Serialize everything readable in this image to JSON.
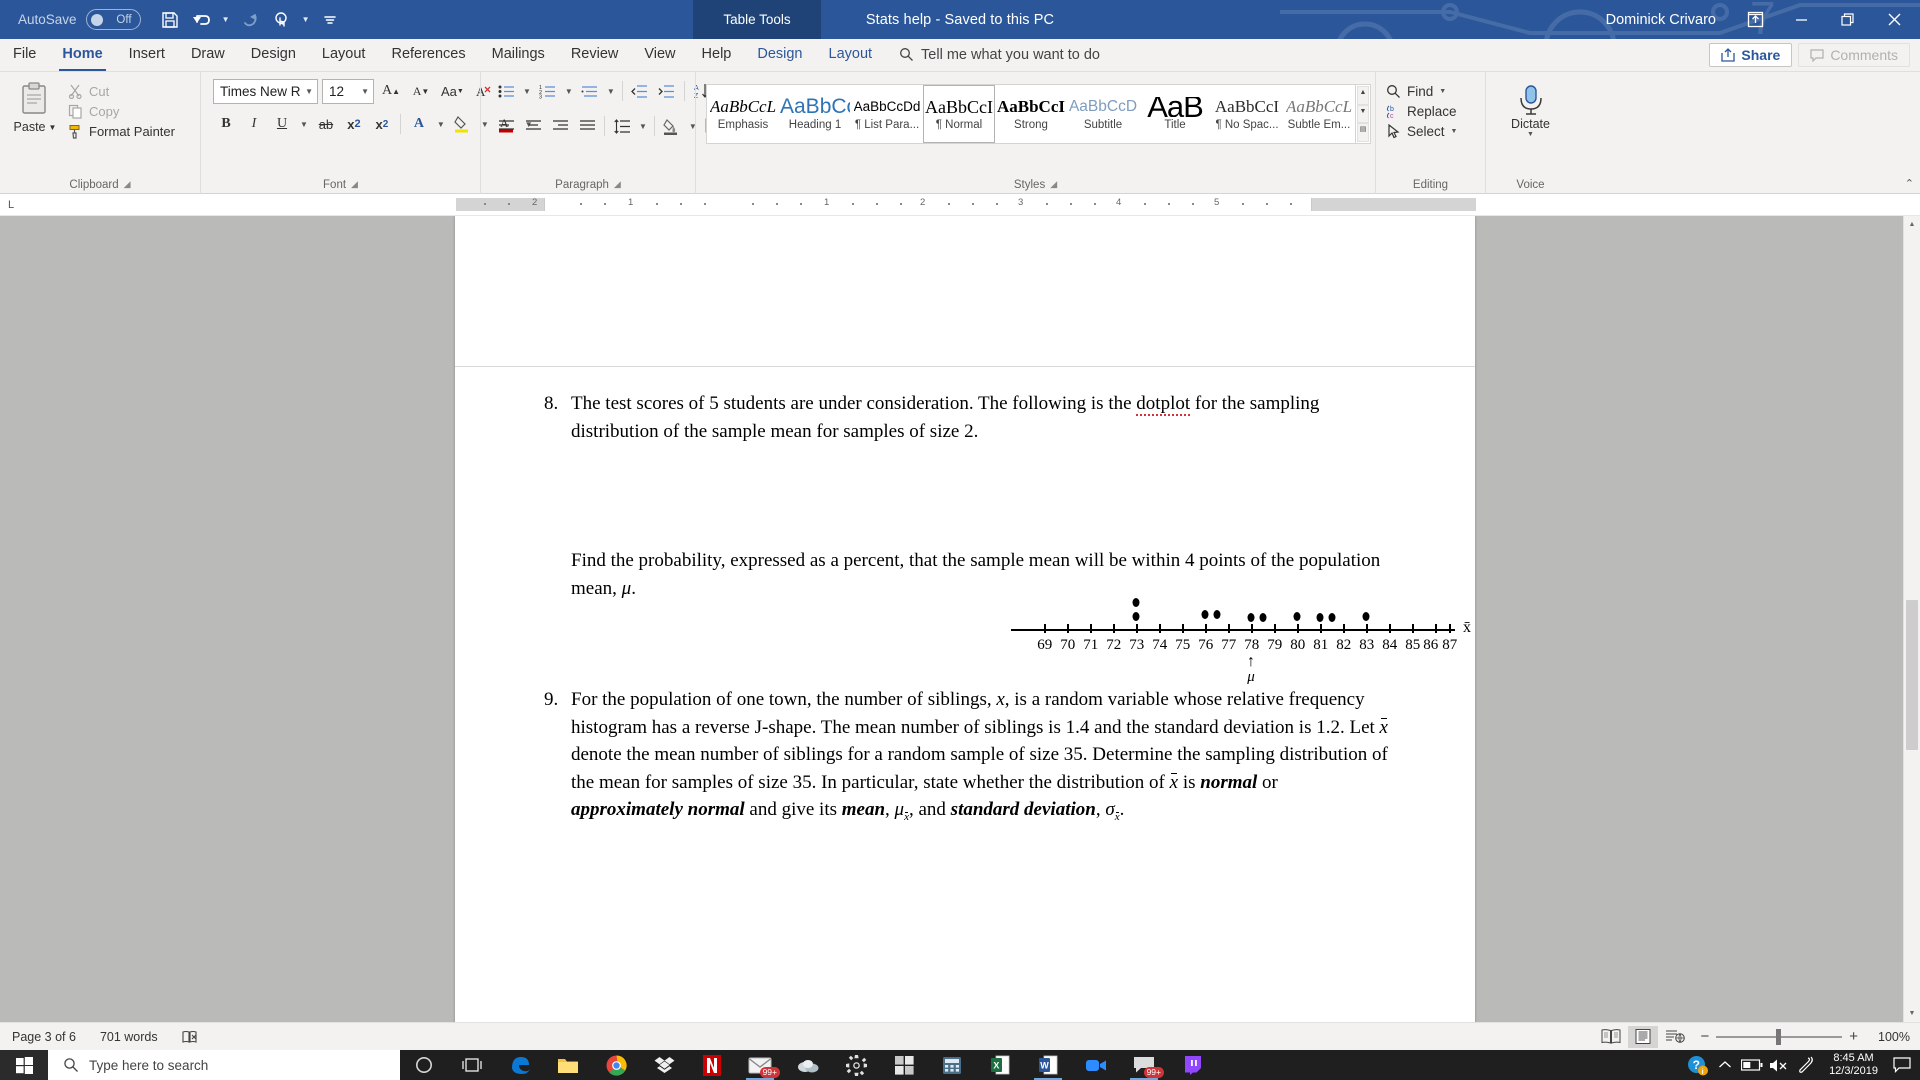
{
  "titlebar": {
    "autosave_label": "AutoSave",
    "autosave_state": "Off",
    "document_title": "Stats help  -  Saved to this PC",
    "contextual_tab": "Table Tools",
    "username": "Dominick Crivaro",
    "quick_access": [
      "save-icon",
      "undo-icon",
      "redo-icon",
      "touch-mode-icon",
      "customize-qat-icon"
    ],
    "window_controls": [
      "ribbon-display-options-icon",
      "minimize-icon",
      "restore-icon",
      "close-icon"
    ],
    "accent_color": "#2b579a",
    "contextual_color": "#1f4277"
  },
  "ribbon": {
    "tabs": [
      {
        "label": "File",
        "active": false,
        "contextual": false
      },
      {
        "label": "Home",
        "active": true,
        "contextual": false
      },
      {
        "label": "Insert",
        "active": false,
        "contextual": false
      },
      {
        "label": "Draw",
        "active": false,
        "contextual": false
      },
      {
        "label": "Design",
        "active": false,
        "contextual": false
      },
      {
        "label": "Layout",
        "active": false,
        "contextual": false
      },
      {
        "label": "References",
        "active": false,
        "contextual": false
      },
      {
        "label": "Mailings",
        "active": false,
        "contextual": false
      },
      {
        "label": "Review",
        "active": false,
        "contextual": false
      },
      {
        "label": "View",
        "active": false,
        "contextual": false
      },
      {
        "label": "Help",
        "active": false,
        "contextual": false
      },
      {
        "label": "Design",
        "active": false,
        "contextual": true
      },
      {
        "label": "Layout",
        "active": false,
        "contextual": true
      }
    ],
    "tellme_placeholder": "Tell me what you want to do",
    "share_label": "Share",
    "comments_label": "Comments",
    "clipboard": {
      "group_label": "Clipboard",
      "paste_label": "Paste",
      "cut_label": "Cut",
      "copy_label": "Copy",
      "format_painter_label": "Format Painter"
    },
    "font": {
      "group_label": "Font",
      "font_name": "Times New Rom",
      "font_size": "12",
      "buttons": [
        "grow-font-icon",
        "shrink-font-icon",
        "change-case-icon",
        "clear-formatting-icon",
        "bold-icon",
        "italic-icon",
        "underline-icon",
        "strikethrough-icon",
        "subscript-icon",
        "superscript-icon",
        "text-effects-icon",
        "text-highlight-icon",
        "font-color-icon"
      ],
      "bold_label": "B",
      "italic_label": "I",
      "underline_label": "U",
      "strikethrough_label": "ab",
      "subscript_label": "x",
      "superscript_label": "x",
      "case_label": "Aa"
    },
    "paragraph": {
      "group_label": "Paragraph",
      "buttons": [
        "bullets-icon",
        "numbering-icon",
        "multilevel-list-icon",
        "decrease-indent-icon",
        "increase-indent-icon",
        "sort-icon",
        "show-formatting-marks-icon",
        "align-left-icon",
        "align-center-icon",
        "align-right-icon",
        "justify-icon",
        "line-spacing-icon",
        "shading-icon",
        "borders-icon"
      ]
    },
    "styles": {
      "group_label": "Styles",
      "items": [
        {
          "preview": "AaBbCcL",
          "name": "Emphasis",
          "selected": false,
          "style": "emphasis"
        },
        {
          "preview": "AaBbCc",
          "name": "Heading 1",
          "selected": false,
          "style": "heading1"
        },
        {
          "preview": "AaBbCcDd",
          "name": "¶ List Para...",
          "selected": false,
          "style": "listpara"
        },
        {
          "preview": "AaBbCcI",
          "name": "¶ Normal",
          "selected": true,
          "style": "normal"
        },
        {
          "preview": "AaBbCcI",
          "name": "Strong",
          "selected": false,
          "style": "strong"
        },
        {
          "preview": "AaBbCcD",
          "name": "Subtitle",
          "selected": false,
          "style": "subtitle"
        },
        {
          "preview": "AaB",
          "name": "Title",
          "selected": false,
          "style": "title"
        },
        {
          "preview": "AaBbCcI",
          "name": "¶ No Spac...",
          "selected": false,
          "style": "nospacing"
        },
        {
          "preview": "AaBbCcL",
          "name": "Subtle Em...",
          "selected": false,
          "style": "subtleem"
        }
      ]
    },
    "editing": {
      "group_label": "Editing",
      "find_label": "Find",
      "replace_label": "Replace",
      "select_label": "Select"
    },
    "voice": {
      "group_label": "Voice",
      "dictate_label": "Dictate"
    }
  },
  "ruler": {
    "corner_marker": "L",
    "labels": [
      "2",
      "1",
      "1",
      "2",
      "3",
      "4",
      "5"
    ]
  },
  "document": {
    "questions": [
      {
        "number": "8.",
        "lines": [
          "The test scores of 5 students are under consideration. The following is the dotplot for the sampling",
          "distribution of the sample mean for samples of size 2."
        ],
        "misspelled_word": "dotplot"
      },
      {
        "number": "",
        "lines": [
          "Find the probability, expressed as a percent, that the sample mean will be within 4 points of the population",
          "mean, μ."
        ]
      },
      {
        "number": "9.",
        "lines": [
          "For the population of one town, the number of siblings, x, is a random variable whose relative frequency",
          "histogram has a reverse J-shape.  The mean number of siblings is 1.4 and the standard deviation is 1.2.  Let x̄",
          "denote the mean number of siblings for a random sample of size 35. Determine the sampling distribution of",
          "the mean for samples of size 35.  In particular, state whether the distribution of x̄ is normal or",
          "approximately normal and give its mean, μₓ̄, and standard deviation, σₓ̄."
        ]
      }
    ]
  },
  "chart_data": {
    "type": "scatter",
    "title": "Dotplot of sampling distribution of the sample mean (samples of size 2)",
    "xlabel": "x̄",
    "xlim": [
      69,
      87
    ],
    "tick_labels": [
      "69",
      "70",
      "71",
      "72",
      "73",
      "74",
      "75",
      "76",
      "77",
      "78",
      "79",
      "80",
      "81",
      "82",
      "83",
      "84",
      "85",
      "86",
      "87"
    ],
    "grid": false,
    "legend": "none",
    "annotations": [
      {
        "label": "μ",
        "x": 78,
        "marker": "up-arrow",
        "position": "below-axis"
      }
    ],
    "dots": [
      {
        "x": 73,
        "stack": 1
      },
      {
        "x": 73,
        "stack": 2
      },
      {
        "x": 76,
        "stack": 1
      },
      {
        "x": 76.5,
        "stack": 1
      },
      {
        "x": 78,
        "stack": 1
      },
      {
        "x": 78.5,
        "stack": 1
      },
      {
        "x": 80,
        "stack": 1
      },
      {
        "x": 81,
        "stack": 1
      },
      {
        "x": 81.5,
        "stack": 1
      },
      {
        "x": 83,
        "stack": 1
      }
    ]
  },
  "statusbar": {
    "page_info": "Page 3 of 6",
    "word_count": "701 words",
    "proofing_icon": "proofing-errors-icon",
    "views": [
      {
        "name": "read-mode-view",
        "active": false
      },
      {
        "name": "print-layout-view",
        "active": true
      },
      {
        "name": "web-layout-view",
        "active": false
      }
    ],
    "zoom_out_label": "−",
    "zoom_in_label": "+",
    "zoom_level": "100%"
  },
  "taskbar": {
    "search_placeholder": "Type here to search",
    "icons": [
      {
        "name": "task-view-icon",
        "badge": ""
      },
      {
        "name": "cortana-icon",
        "badge": ""
      },
      {
        "name": "edge-icon",
        "badge": ""
      },
      {
        "name": "file-explorer-icon",
        "badge": ""
      },
      {
        "name": "chrome-icon",
        "badge": ""
      },
      {
        "name": "dropbox-icon",
        "badge": ""
      },
      {
        "name": "netflix-icon",
        "badge": ""
      },
      {
        "name": "mail-icon",
        "badge": "99+"
      },
      {
        "name": "weather-icon",
        "badge": ""
      },
      {
        "name": "settings-icon",
        "badge": ""
      },
      {
        "name": "store-icon",
        "badge": ""
      },
      {
        "name": "calculator-icon",
        "badge": ""
      },
      {
        "name": "excel-icon",
        "badge": ""
      },
      {
        "name": "word-icon",
        "badge": ""
      },
      {
        "name": "zoom-icon",
        "badge": ""
      },
      {
        "name": "messages-icon",
        "badge": "99+"
      },
      {
        "name": "twitch-icon",
        "badge": ""
      }
    ],
    "tray": {
      "help-icon": "?",
      "show_hidden_icons": "chevron-up-icon",
      "battery": "battery-icon",
      "volume": "volume-muted-icon",
      "pen": "pen-icon",
      "time": "8:45 AM",
      "date": "12/3/2019",
      "action_center": "action-center-icon"
    }
  }
}
